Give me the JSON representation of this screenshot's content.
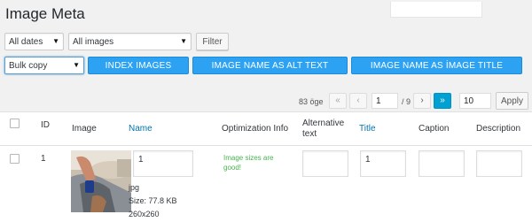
{
  "page": {
    "title": "Image Meta"
  },
  "filters": {
    "dates": "All dates",
    "types": "All images",
    "filter_button": "Filter"
  },
  "bulk": {
    "action": "Bulk copy",
    "buttons": [
      "INDEX IMAGES",
      "IMAGE NAME AS ALT TEXT",
      "IMAGE NAME AS İMAGE TITLE"
    ]
  },
  "pagination": {
    "count": "83 öge",
    "first": "«",
    "prev": "‹",
    "current": "1",
    "total": "/ 9",
    "next": "›",
    "last": "»",
    "per_page": "10",
    "apply": "Apply"
  },
  "table": {
    "headers": {
      "id": "ID",
      "image": "Image",
      "name": "Name",
      "optimization": "Optimization Info",
      "alt": "Alternative text",
      "title": "Title",
      "caption": "Caption",
      "description": "Description"
    },
    "rows": [
      {
        "id": "1",
        "name_value": "1",
        "ext": "jpg",
        "size": "Size: 77.8 KB",
        "dimensions": "260x260",
        "optimization": "Image sizes are good!",
        "alt": "",
        "title": "1",
        "caption": "",
        "description": ""
      }
    ]
  },
  "colors": {
    "accent_blue": "#2ea2f2",
    "link_blue": "#0073aa",
    "status_green": "#46b450",
    "page_bg": "#f1f1f1"
  }
}
